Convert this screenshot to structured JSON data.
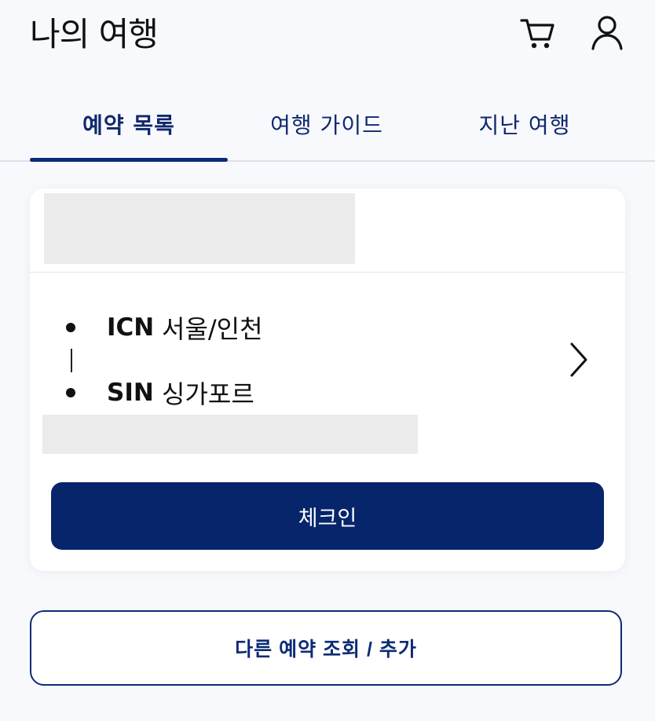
{
  "header": {
    "title": "나의 여행",
    "cart_icon": "cart-icon",
    "user_icon": "user-icon"
  },
  "tabs": [
    {
      "label": "예약 목록",
      "selected": true
    },
    {
      "label": "여행 가이드",
      "selected": false
    },
    {
      "label": "지난 여행",
      "selected": false
    }
  ],
  "booking_card": {
    "origin": {
      "code": "ICN",
      "city": "서울/인천"
    },
    "destination": {
      "code": "SIN",
      "city": "싱가포르"
    },
    "route_separator": "|",
    "chevron_icon": "chevron-right-icon",
    "checkin_label": "체크인"
  },
  "other_booking_label": "다른 예약 조회 / 추가",
  "colors": {
    "primary": "#06256b",
    "tab_text": "#11286b",
    "background": "#f7f9fd",
    "placeholder": "#ebebeb"
  }
}
